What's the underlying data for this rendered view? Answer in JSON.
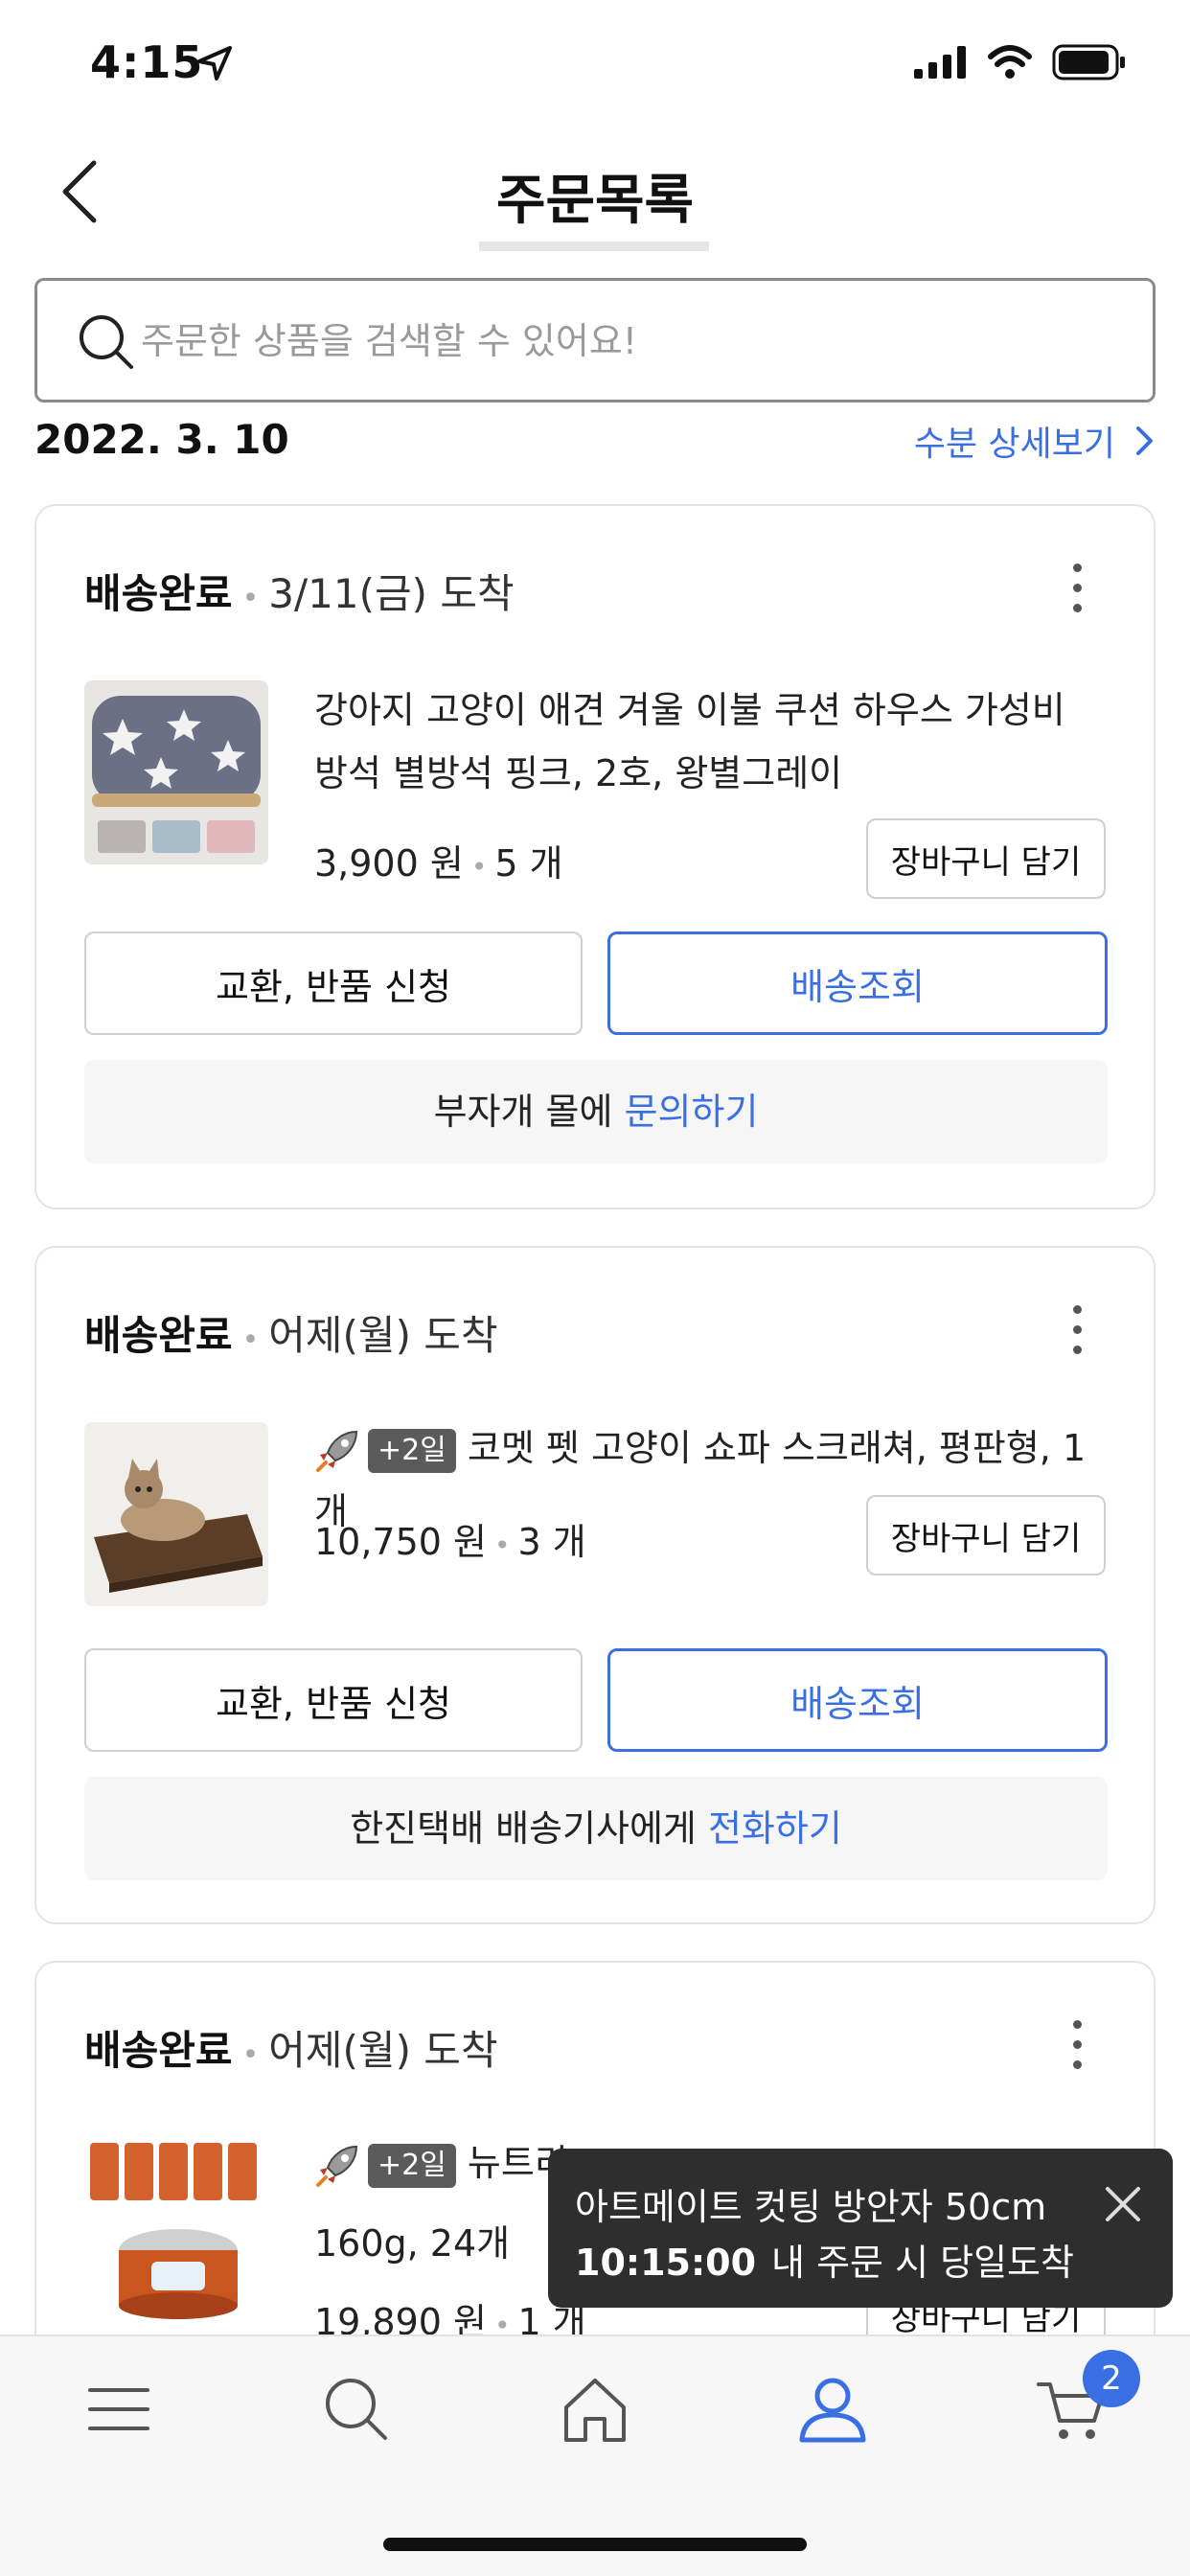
{
  "status_bar": {
    "time": "4:15"
  },
  "nav": {
    "title": "주문목록"
  },
  "search": {
    "placeholder": "주문한 상품을 검색할 수 있어요!"
  },
  "date_group": {
    "date": "2022. 3. 10",
    "detail_label": "수분 상세보기"
  },
  "orders": [
    {
      "status": "배송완료",
      "arrival": "3/11(금) 도착",
      "title": "강아지 고양이 애견 겨울 이불 쿠션 하우스 가성비 방석 별방석 핑크, 2호, 왕별그레이",
      "price": "3,900 원",
      "qty": "5 개",
      "cart_label": "장바구니 담기",
      "exchange_label": "교환, 반품 신청",
      "track_label": "배송조회",
      "contact_prefix": "부자개 몰에",
      "contact_link": "문의하기"
    },
    {
      "status": "배송완료",
      "arrival": "어제(월) 도착",
      "badge": "+2일",
      "title": "코멧 펫 고양이 쇼파 스크래쳐, 평판형, 1개",
      "price": "10,750 원",
      "qty": "3 개",
      "cart_label": "장바구니 담기",
      "exchange_label": "교환, 반품 신청",
      "track_label": "배송조회",
      "contact_prefix": "한진택배  배송기사에게",
      "contact_link": "전화하기"
    },
    {
      "status": "배송완료",
      "arrival": "어제(월) 도착",
      "badge": "+2일",
      "title_partial": "뉴트리",
      "title_line2": "160g, 24개",
      "price": "19,890 원",
      "qty": "1 개",
      "cart_label": "장바구니 담기"
    }
  ],
  "toast": {
    "product": "아트메이트 컷팅 방안자 50cm",
    "time": "10:15:00",
    "message": "내 주문 시 당일도착"
  },
  "tabbar": {
    "cart_count": "2"
  },
  "colors": {
    "accent": "#3a6fe3",
    "toast_bg": "#2e2e2e",
    "badge_bg": "#5b5b5b"
  }
}
